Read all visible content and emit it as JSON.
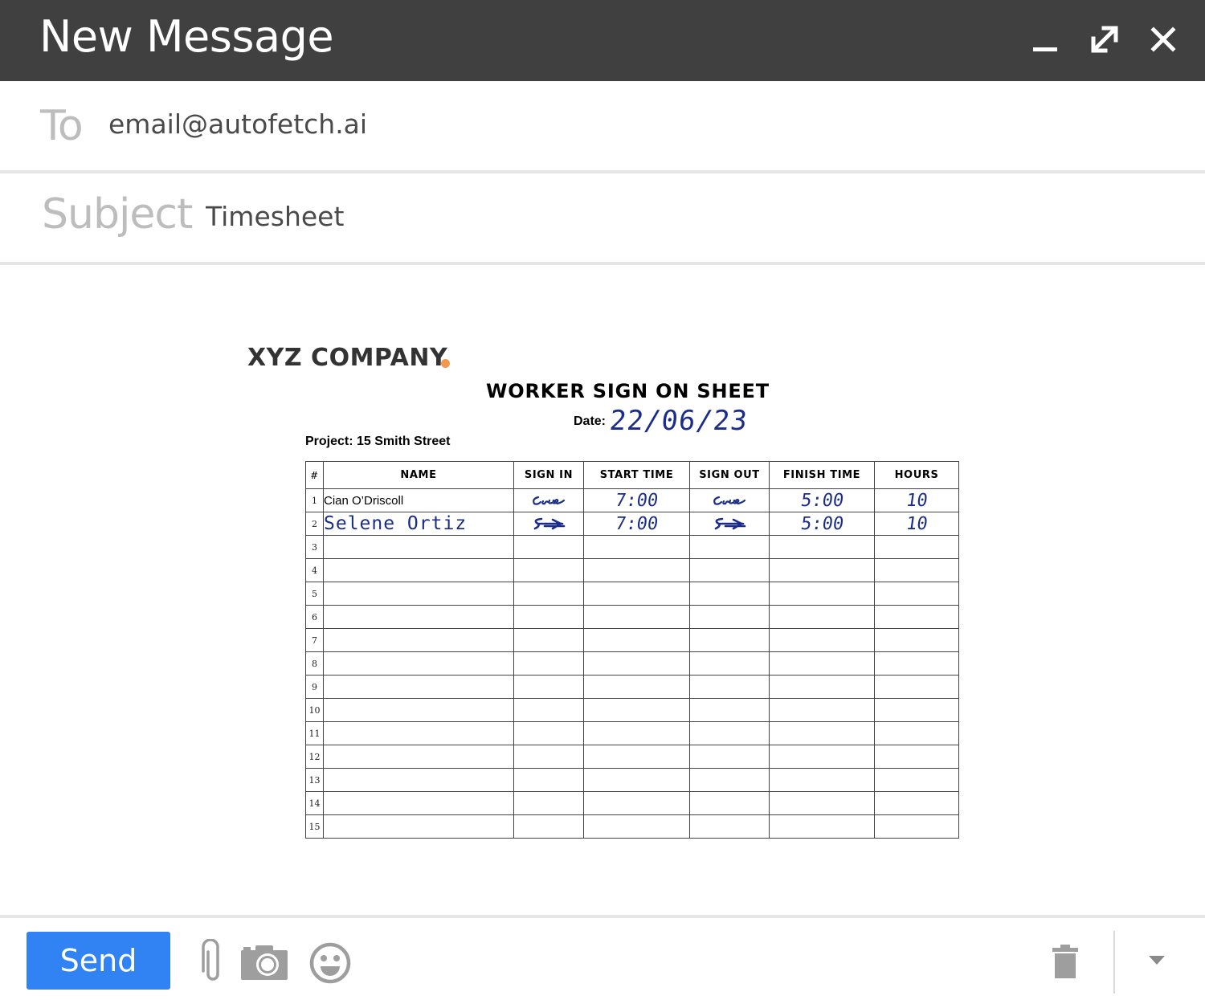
{
  "window": {
    "title": "New Message",
    "controls": [
      "minimize-icon",
      "expand-icon",
      "close-icon"
    ]
  },
  "header": {
    "to_label": "To",
    "to_value": "email@autofetch.ai",
    "subject_label": "Subject",
    "subject_value": "Timesheet"
  },
  "document": {
    "company": "XYZ COMPANY",
    "title": "WORKER SIGN ON SHEET",
    "date_label": "Date:",
    "date_value": "22/06/23",
    "project": "Project: 15 Smith Street",
    "columns": [
      "#",
      "NAME",
      "SIGN IN",
      "START TIME",
      "SIGN OUT",
      "FINISH TIME",
      "HOURS"
    ],
    "rows": [
      {
        "num": "1",
        "name": "Cian O’Driscoll",
        "name_handwritten": false,
        "start_time": "7:00",
        "finish_time": "5:00",
        "hours": "10",
        "signature": "signature-1"
      },
      {
        "num": "2",
        "name": "Selene Ortiz",
        "name_handwritten": true,
        "start_time": "7:00",
        "finish_time": "5:00",
        "hours": "10",
        "signature": "signature-2"
      },
      {
        "num": "3"
      },
      {
        "num": "4"
      },
      {
        "num": "5"
      },
      {
        "num": "6"
      },
      {
        "num": "7"
      },
      {
        "num": "8"
      },
      {
        "num": "9"
      },
      {
        "num": "10"
      },
      {
        "num": "11"
      },
      {
        "num": "12"
      },
      {
        "num": "13"
      },
      {
        "num": "14"
      },
      {
        "num": "15"
      }
    ]
  },
  "toolbar": {
    "send_label": "Send",
    "icons": [
      "paperclip-icon",
      "camera-icon",
      "emoji-icon",
      "trash-icon",
      "dropdown-arrow-icon"
    ]
  },
  "colors": {
    "title_bar": "#404040",
    "send_button": "#3182f2",
    "handwriting": "#1a2d8a",
    "company_dot": "#f2984f"
  }
}
